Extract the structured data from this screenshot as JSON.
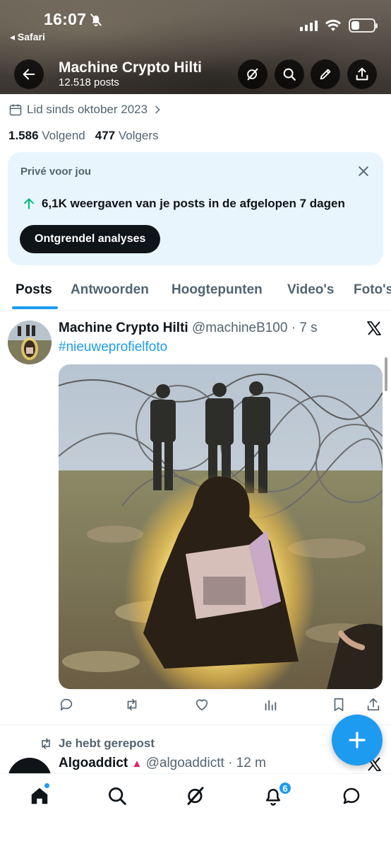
{
  "status_bar": {
    "time": "16:07",
    "back_app": "◂ Safari",
    "battery_level": 0.35
  },
  "header": {
    "name": "Machine Crypto Hilti",
    "post_count": "12.518 posts",
    "icons": [
      "back-arrow-icon",
      "grok-icon",
      "search-icon",
      "edit-pen-icon",
      "share-icon"
    ]
  },
  "profile": {
    "joined": "Lid sinds oktober 2023",
    "following_count": "1.586",
    "following_label": "Volgend",
    "followers_count": "477",
    "followers_label": "Volgers"
  },
  "analytics_card": {
    "title": "Privé voor jou",
    "stat": "6,1K weergaven van je posts in de afgelopen 7 dagen",
    "button": "Ontgrendel analyses"
  },
  "tabs": [
    "Posts",
    "Antwoorden",
    "Hoogtepunten",
    "Video's",
    "Foto's"
  ],
  "active_tab": "Posts",
  "post": {
    "name": "Machine Crypto Hilti",
    "handle": "@machineB100",
    "time": "· 7 s",
    "text": "#nieuweprofielfoto"
  },
  "repost": {
    "label": "Je hebt gerepost",
    "name": "Algoaddict",
    "handle": "@algoaddictt",
    "time": "· 12 m"
  },
  "bottom_nav": {
    "items": [
      "home-icon",
      "search-icon",
      "grok-icon",
      "notifications-icon",
      "messages-icon"
    ],
    "notification_count": "6"
  },
  "colors": {
    "accent": "#1d9bf0",
    "text_primary": "#0f1419",
    "text_secondary": "#536471",
    "card_bg": "#e8f5fd",
    "growth_green": "#00ba7c"
  }
}
